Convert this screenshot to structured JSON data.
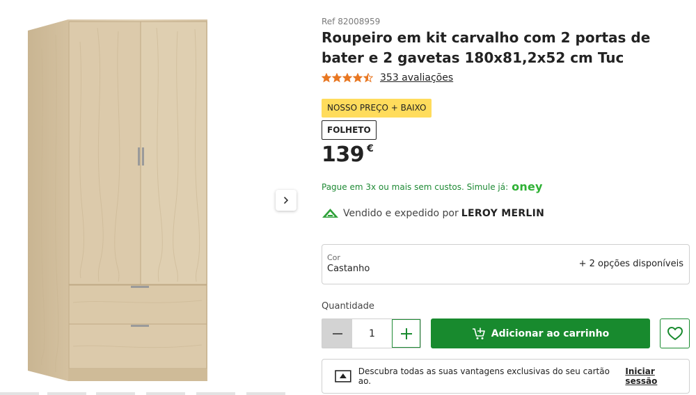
{
  "product": {
    "ref": "Ref 82008959",
    "title": "Roupeiro em kit carvalho com 2 portas de bater e 2 gavetas 180x81,2x52 cm Tuc",
    "rating": 4.5,
    "rating_max": 5,
    "reviews_label": "353 avaliações",
    "badge_price": "NOSSO PREÇO + BAIXO",
    "badge_flyer": "FOLHETO",
    "price": "139",
    "currency": "€",
    "installments_text": "Pague em 3x ou mais sem custos. Simule já:",
    "installments_brand": "oney",
    "seller_text": "Vendido e expedido por",
    "seller_name": "LEROY MERLIN"
  },
  "variant": {
    "label": "Cor",
    "value": "Castanho",
    "options": "+ 2 opções disponíveis"
  },
  "quantity": {
    "label": "Quantidade",
    "value": "1"
  },
  "actions": {
    "add_to_cart": "Adicionar ao carrinho"
  },
  "promo": {
    "text": "Descubra todas as suas vantagens exclusivas do seu cartão ao.",
    "link": "Iniciar sessão"
  },
  "icons": {
    "star": "star-icon",
    "next": "chevron-right-icon",
    "cart": "cart-plus-icon",
    "heart": "heart-icon",
    "card": "card-icon",
    "seller": "leroy-merlin-logo"
  },
  "colors": {
    "accent_green": "#188a2e",
    "badge_yellow": "#ffdc5c",
    "star_orange": "#e87722"
  }
}
